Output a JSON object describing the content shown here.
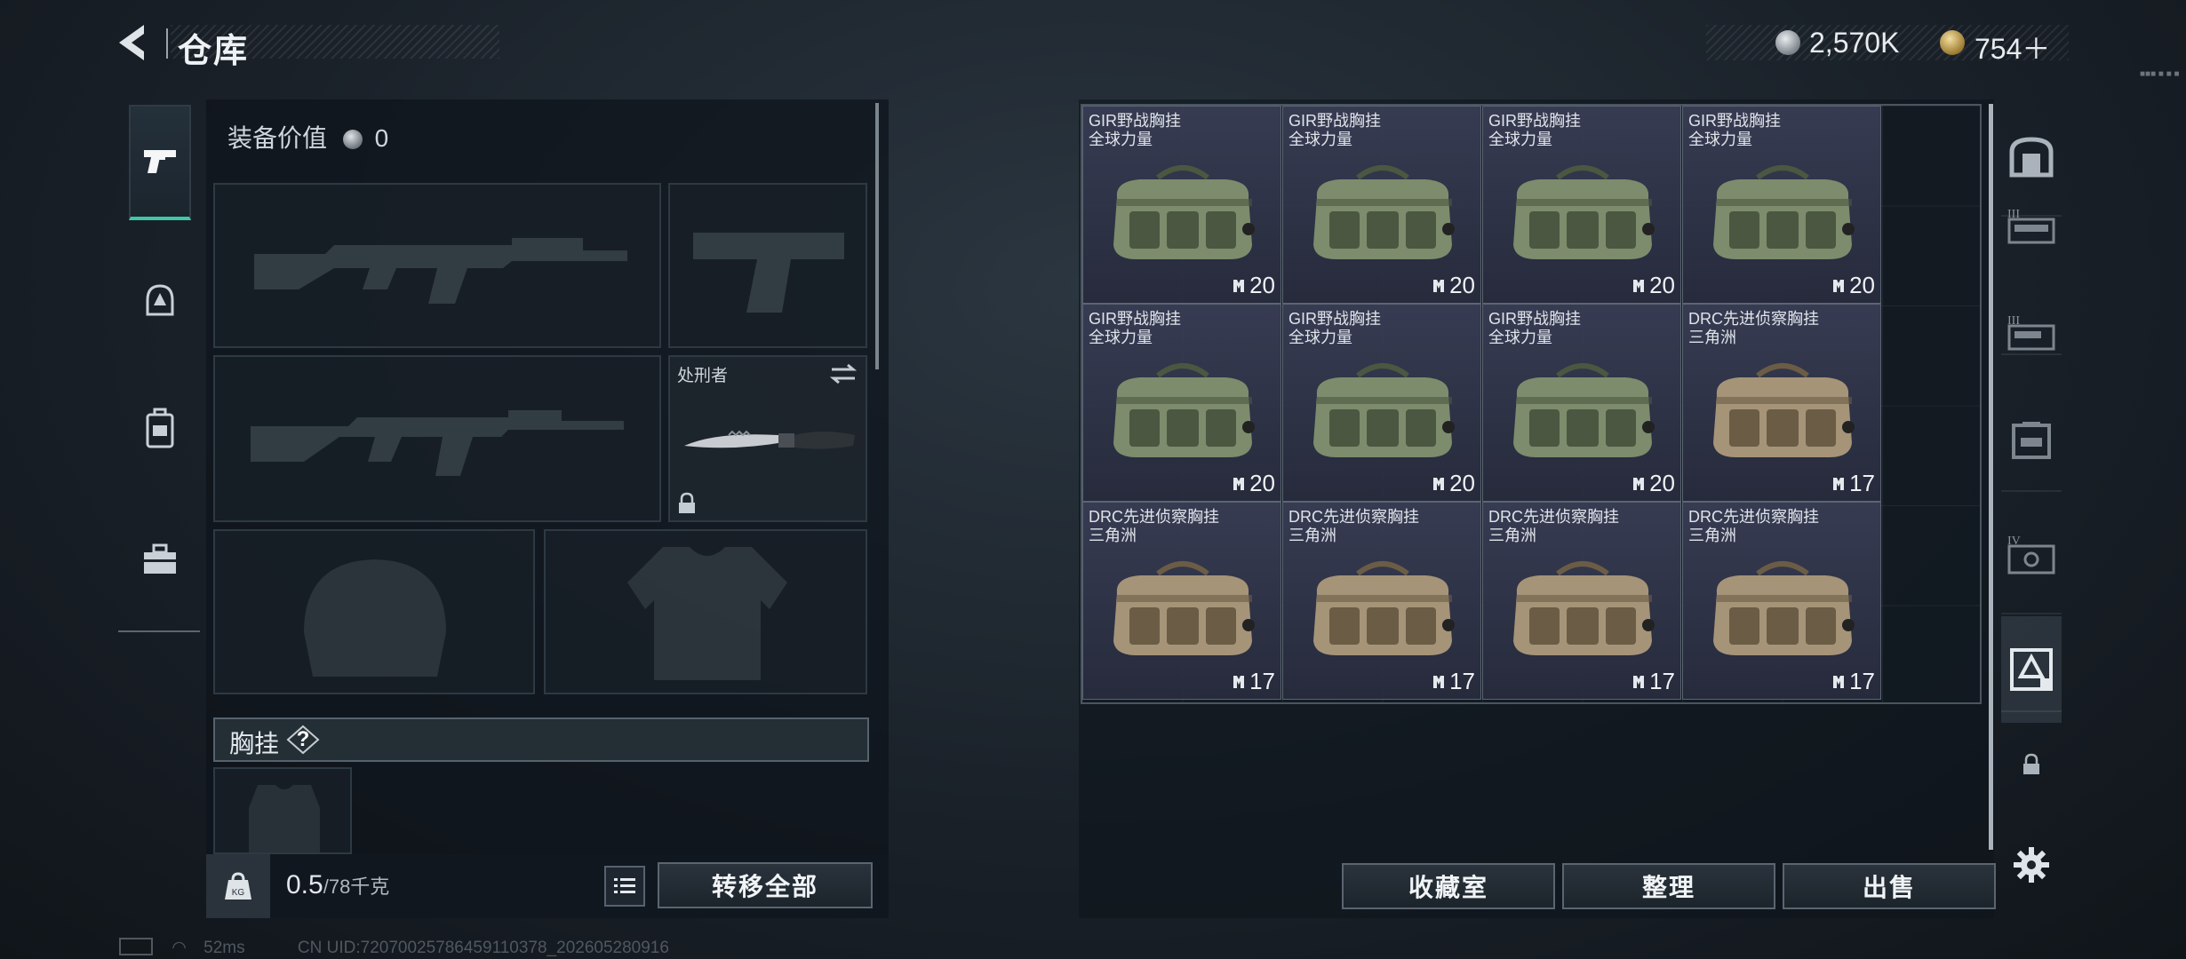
{
  "header": {
    "title": "仓库",
    "currency_silver": "2,570K",
    "currency_gold": "754＋",
    "version_tiny": "■■■ ■ ■ ■"
  },
  "left_tabs": [
    {
      "icon": "pistol-icon",
      "active": true
    },
    {
      "icon": "helmet-icon",
      "active": false
    },
    {
      "icon": "backpack-icon",
      "active": false
    },
    {
      "icon": "toolbox-icon",
      "active": false
    }
  ],
  "loadout": {
    "value_label": "装备价值",
    "value_amount": "0",
    "melee_name": "处刑者",
    "chest_rig_title": "胸挂",
    "help": "?",
    "weight_current": "0.5",
    "weight_max": "/78千克",
    "transfer_all": "转移全部"
  },
  "storage": {
    "items": [
      {
        "name1": "GIR野战胸挂",
        "name2": "全球力量",
        "count": "20",
        "tint": "green"
      },
      {
        "name1": "GIR野战胸挂",
        "name2": "全球力量",
        "count": "20",
        "tint": "green"
      },
      {
        "name1": "GIR野战胸挂",
        "name2": "全球力量",
        "count": "20",
        "tint": "green"
      },
      {
        "name1": "GIR野战胸挂",
        "name2": "全球力量",
        "count": "20",
        "tint": "green"
      },
      {
        "name1": "GIR野战胸挂",
        "name2": "全球力量",
        "count": "20",
        "tint": "green"
      },
      {
        "name1": "GIR野战胸挂",
        "name2": "全球力量",
        "count": "20",
        "tint": "green"
      },
      {
        "name1": "GIR野战胸挂",
        "name2": "全球力量",
        "count": "20",
        "tint": "green"
      },
      {
        "name1": "DRC先进侦察胸挂",
        "name2": "三角洲",
        "count": "17",
        "tint": "tan"
      },
      {
        "name1": "DRC先进侦察胸挂",
        "name2": "三角洲",
        "count": "17",
        "tint": "tan"
      },
      {
        "name1": "DRC先进侦察胸挂",
        "name2": "三角洲",
        "count": "17",
        "tint": "tan"
      },
      {
        "name1": "DRC先进侦察胸挂",
        "name2": "三角洲",
        "count": "17",
        "tint": "tan"
      },
      {
        "name1": "DRC先进侦察胸挂",
        "name2": "三角洲",
        "count": "17",
        "tint": "tan"
      }
    ],
    "btn_collection": "收藏室",
    "btn_sort": "整理",
    "btn_sell": "出售"
  },
  "right_tabs": [
    {
      "icon": "safe-box-icon",
      "label": ""
    },
    {
      "icon": "storage-1-icon",
      "label": "III"
    },
    {
      "icon": "storage-2-icon",
      "label": "III"
    },
    {
      "icon": "storage-3-icon",
      "label": ""
    },
    {
      "icon": "storage-4-icon",
      "label": "IV"
    },
    {
      "icon": "storage-5-icon",
      "label": ""
    },
    {
      "icon": "lock-icon",
      "label": ""
    }
  ],
  "status": {
    "ping": "52ms",
    "uid": "CN UID:72070025786459110378_202605280916"
  },
  "colors": {
    "accent": "#40c7a8",
    "bag_green": "#7d8c6c",
    "bag_tan": "#a69478",
    "cell_bg": "#3a3e56"
  }
}
